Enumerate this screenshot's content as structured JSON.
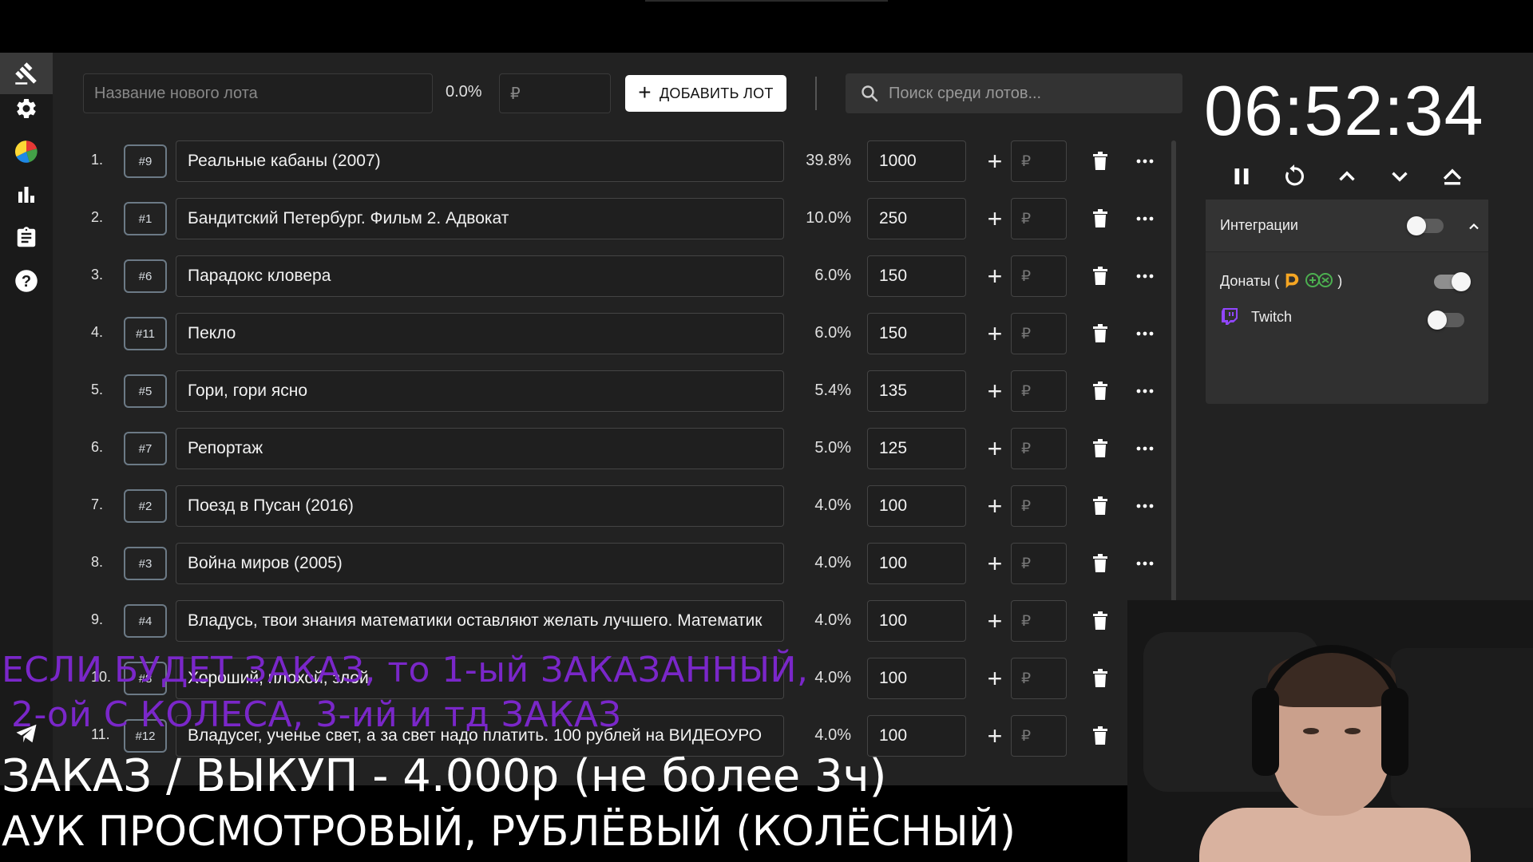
{
  "toolbar": {
    "new_lot_placeholder": "Название нового лота",
    "new_lot_percent": "0.0%",
    "amount_placeholder": "₽",
    "add_button_label": "ДОБАВИТЬ ЛОТ",
    "search_placeholder": "Поиск среди лотов..."
  },
  "sidebar": {
    "items": [
      {
        "icon": "gavel-icon",
        "active": true
      },
      {
        "icon": "gear-icon",
        "active": false
      },
      {
        "icon": "pie-chart-icon",
        "active": false
      },
      {
        "icon": "bar-chart-icon",
        "active": false
      },
      {
        "icon": "clipboard-icon",
        "active": false
      },
      {
        "icon": "help-icon",
        "active": false
      }
    ]
  },
  "lots": [
    {
      "index": "1.",
      "id": "#9",
      "name": "Реальные кабаны (2007)",
      "percent": "39.8%",
      "amount": "1000",
      "rub": "₽",
      "more": true
    },
    {
      "index": "2.",
      "id": "#1",
      "name": "Бандитский Петербург. Фильм 2. Адвокат",
      "percent": "10.0%",
      "amount": "250",
      "rub": "₽",
      "more": true
    },
    {
      "index": "3.",
      "id": "#6",
      "name": "Парадокс кловера",
      "percent": "6.0%",
      "amount": "150",
      "rub": "₽",
      "more": true
    },
    {
      "index": "4.",
      "id": "#11",
      "name": "Пекло",
      "percent": "6.0%",
      "amount": "150",
      "rub": "₽",
      "more": true
    },
    {
      "index": "5.",
      "id": "#5",
      "name": "Гори, гори ясно",
      "percent": "5.4%",
      "amount": "135",
      "rub": "₽",
      "more": true
    },
    {
      "index": "6.",
      "id": "#7",
      "name": "Репортаж",
      "percent": "5.0%",
      "amount": "125",
      "rub": "₽",
      "more": true
    },
    {
      "index": "7.",
      "id": "#2",
      "name": "Поезд в Пусан (2016)",
      "percent": "4.0%",
      "amount": "100",
      "rub": "₽",
      "more": true
    },
    {
      "index": "8.",
      "id": "#3",
      "name": "Война миров (2005)",
      "percent": "4.0%",
      "amount": "100",
      "rub": "₽",
      "more": true
    },
    {
      "index": "9.",
      "id": "#4",
      "name": "Владусь, твои знания математики оставляют желать лучшего. Математик",
      "percent": "4.0%",
      "amount": "100",
      "rub": "₽",
      "more": false
    },
    {
      "index": "10.",
      "id": "#8",
      "name": "Хороший, плохой, злой",
      "percent": "4.0%",
      "amount": "100",
      "rub": "₽",
      "more": false
    },
    {
      "index": "11.",
      "id": "#12",
      "name": "Владусег, ученье свет, а за свет надо платить. 100 рублей на ВИДЕОУРО",
      "percent": "4.0%",
      "amount": "100",
      "rub": "₽",
      "more": false
    }
  ],
  "timer": {
    "value": "06:52:34"
  },
  "integrations": {
    "title": "Интеграции",
    "master_enabled": false,
    "items": [
      {
        "label": "Донаты (",
        "suffix": ")",
        "enabled": true
      },
      {
        "label": "Twitch",
        "enabled": false
      }
    ]
  },
  "stream_overlay": {
    "purple_line1": "ЕСЛИ БУДЕТ ЗАКАЗ, то 1-ый ЗАКАЗАННЫЙ,",
    "purple_line2": "2-ой С КОЛЕСА, 3-ий и тд ЗАКАЗ",
    "white_line1": "ЗАКАЗ / ВЫКУП - 4.000р (не более 3ч)",
    "white_line2": "АУК ПРОСМОТРОВЫЙ, РУБЛЁВЫЙ (КОЛЁСНЫЙ)"
  },
  "colors": {
    "background": "#222222",
    "sidebar": "#1a1a1a",
    "overlay_purple": "#7a27c9",
    "donation_orange": "#f5a623",
    "donation_green": "#4caf50",
    "twitch_purple": "#9146ff"
  }
}
